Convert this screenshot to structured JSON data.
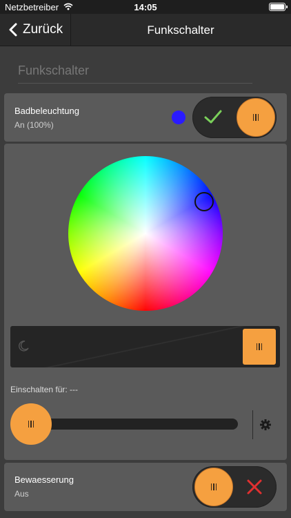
{
  "status_bar": {
    "carrier": "Netzbetreiber",
    "time": "14:05"
  },
  "nav": {
    "back_label": "Zurück",
    "title": "Funkschalter"
  },
  "section_header": "Funkschalter",
  "devices": [
    {
      "name": "Badbeleuchtung",
      "status": "An (100%)",
      "color": "#2a1bff",
      "on": true
    },
    {
      "name": "Bewaesserung",
      "status": "Aus",
      "on": false
    }
  ],
  "color_picker": {
    "selected_color": "#2a1bff",
    "brightness_percent": 100
  },
  "timer": {
    "label": "Einschalten für: ---"
  },
  "colors": {
    "accent": "#f5a040",
    "check": "#7ad05a",
    "cross": "#e03030"
  },
  "icons": [
    "wifi-icon",
    "battery-icon",
    "back-chevron-icon",
    "check-icon",
    "cross-icon",
    "moon-icon",
    "gear-icon"
  ]
}
